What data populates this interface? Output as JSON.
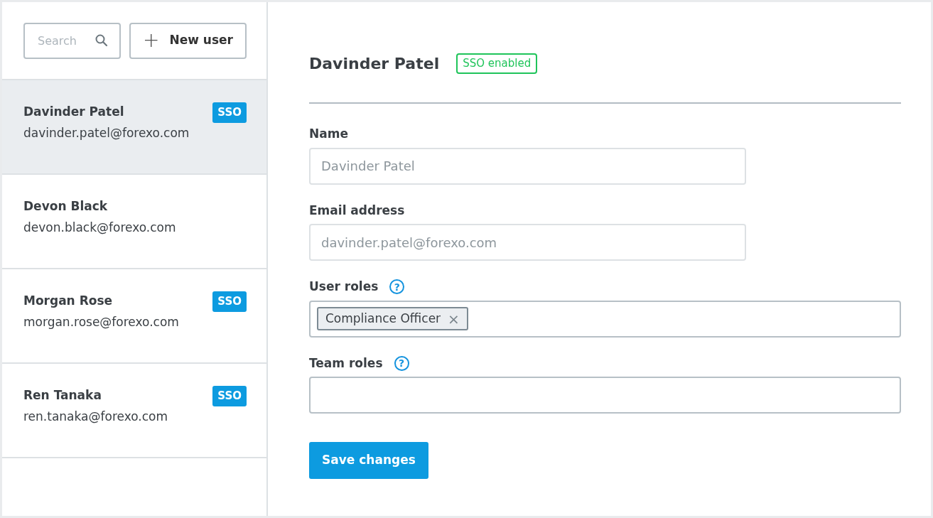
{
  "sidebar": {
    "search": {
      "placeholder": "Search"
    },
    "new_button": {
      "icon": "+",
      "label": "New user"
    },
    "users": [
      {
        "name": "Davinder Patel",
        "email": "davinder.patel@forexo.com",
        "badge": "SSO",
        "selected": true
      },
      {
        "name": "Devon Black",
        "email": "devon.black@forexo.com",
        "selected": false
      },
      {
        "name": "Morgan Rose",
        "email": "morgan.rose@forexo.com",
        "badge": "SSO",
        "selected": false
      },
      {
        "name": "Ren Tanaka",
        "email": "ren.tanaka@forexo.com",
        "badge": "SSO",
        "selected": false
      }
    ]
  },
  "detail": {
    "title": "Davinder Patel",
    "status_badge": "SSO enabled",
    "fields": [
      {
        "kind": "text",
        "label": "Name",
        "value": "Davinder Patel",
        "disabled": true
      },
      {
        "kind": "text",
        "label": "Email address",
        "value": "davinder.patel@forexo.com",
        "disabled": true
      },
      {
        "kind": "tags",
        "label": "User roles",
        "help": "?",
        "tags": [
          {
            "label": "Compliance Officer",
            "remove": "×"
          }
        ]
      },
      {
        "kind": "tags",
        "label": "Team roles",
        "help": "?"
      }
    ],
    "save_button": "Save changes"
  }
}
